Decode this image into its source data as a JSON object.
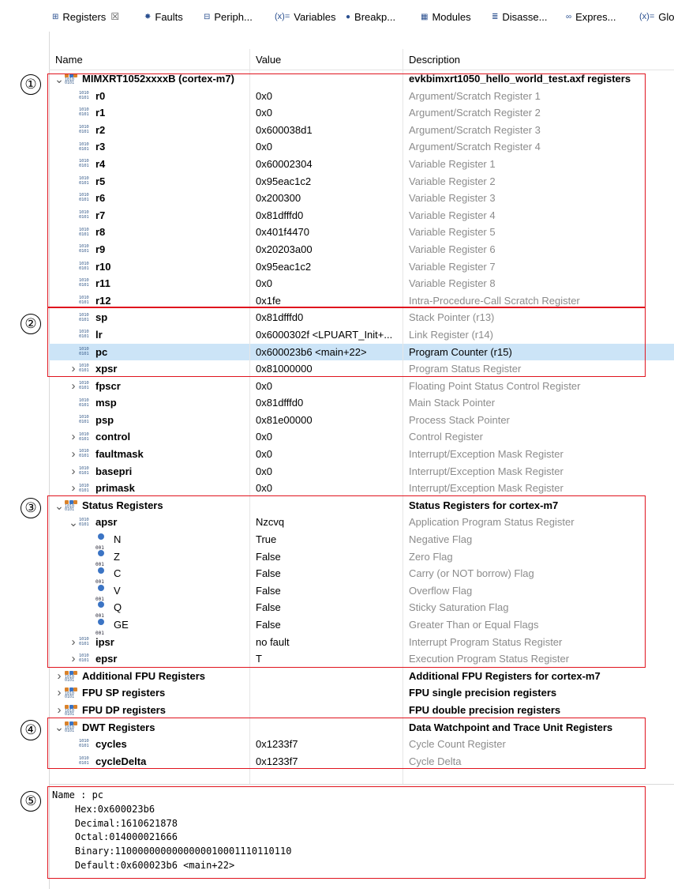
{
  "tabs": [
    {
      "label": "Registers",
      "icon": "registers-icon",
      "active": true
    },
    {
      "label": "Faults",
      "icon": "faults-icon"
    },
    {
      "label": "Periph...",
      "icon": "peripherals-icon"
    },
    {
      "label": "Variables",
      "icon_text": "(x)="
    },
    {
      "label": "Breakp...",
      "icon": "breakpoints-icon"
    },
    {
      "label": "Modules",
      "icon": "modules-icon"
    },
    {
      "label": "Disasse...",
      "icon": "disassembly-icon"
    },
    {
      "label": "Expres...",
      "icon": "expressions-icon"
    },
    {
      "label": "Glo",
      "icon_text": "(x)="
    }
  ],
  "columns": {
    "name": "Name",
    "value": "Value",
    "description": "Description"
  },
  "rows": [
    {
      "name": "MIMXRT1052xxxxB (cortex-m7)",
      "value": "",
      "desc": "evkbimxrt1050_hello_world_test.axf registers",
      "level": 0,
      "twist": "open",
      "icon": "group",
      "group": true
    },
    {
      "name": "r0",
      "value": "0x0",
      "desc": "Argument/Scratch Register 1",
      "level": 1,
      "icon": "bin"
    },
    {
      "name": "r1",
      "value": "0x0",
      "desc": "Argument/Scratch Register 2",
      "level": 1,
      "icon": "bin"
    },
    {
      "name": "r2",
      "value": "0x600038d1",
      "desc": "Argument/Scratch Register 3",
      "level": 1,
      "icon": "bin"
    },
    {
      "name": "r3",
      "value": "0x0",
      "desc": "Argument/Scratch Register 4",
      "level": 1,
      "icon": "bin"
    },
    {
      "name": "r4",
      "value": "0x60002304",
      "desc": "Variable Register 1",
      "level": 1,
      "icon": "bin"
    },
    {
      "name": "r5",
      "value": "0x95eac1c2",
      "desc": "Variable Register 2",
      "level": 1,
      "icon": "bin"
    },
    {
      "name": "r6",
      "value": "0x200300",
      "desc": "Variable Register 3",
      "level": 1,
      "icon": "bin"
    },
    {
      "name": "r7",
      "value": "0x81dfffd0",
      "desc": "Variable Register 4",
      "level": 1,
      "icon": "bin"
    },
    {
      "name": "r8",
      "value": "0x401f4470",
      "desc": "Variable Register 5",
      "level": 1,
      "icon": "bin"
    },
    {
      "name": "r9",
      "value": "0x20203a00",
      "desc": "Variable Register 6",
      "level": 1,
      "icon": "bin"
    },
    {
      "name": "r10",
      "value": "0x95eac1c2",
      "desc": "Variable Register 7",
      "level": 1,
      "icon": "bin"
    },
    {
      "name": "r11",
      "value": "0x0",
      "desc": "Variable Register 8",
      "level": 1,
      "icon": "bin"
    },
    {
      "name": "r12",
      "value": "0x1fe",
      "desc": "Intra-Procedure-Call Scratch Register",
      "level": 1,
      "icon": "bin"
    },
    {
      "name": "sp",
      "value": "0x81dfffd0",
      "desc": "Stack Pointer (r13)",
      "level": 1,
      "icon": "bin"
    },
    {
      "name": "lr",
      "value": "0x6000302f <LPUART_Init+...",
      "desc": "Link Register (r14)",
      "level": 1,
      "icon": "bin"
    },
    {
      "name": "pc",
      "value": "0x600023b6 <main+22>",
      "desc": "Program Counter (r15)",
      "level": 1,
      "icon": "bin",
      "selected": true
    },
    {
      "name": "xpsr",
      "value": "0x81000000",
      "desc": "Program Status Register",
      "level": 1,
      "twist": "closed",
      "icon": "bin"
    },
    {
      "name": "fpscr",
      "value": "0x0",
      "desc": "Floating Point Status Control Register",
      "level": 1,
      "twist": "closed",
      "icon": "bin"
    },
    {
      "name": "msp",
      "value": "0x81dfffd0",
      "desc": "Main Stack Pointer",
      "level": 1,
      "icon": "bin"
    },
    {
      "name": "psp",
      "value": "0x81e00000",
      "desc": "Process Stack Pointer",
      "level": 1,
      "icon": "bin"
    },
    {
      "name": "control",
      "value": "0x0",
      "desc": "Control Register",
      "level": 1,
      "twist": "closed",
      "icon": "bin"
    },
    {
      "name": "faultmask",
      "value": "0x0",
      "desc": "Interrupt/Exception Mask Register",
      "level": 1,
      "twist": "closed",
      "icon": "bin"
    },
    {
      "name": "basepri",
      "value": "0x0",
      "desc": "Interrupt/Exception Mask Register",
      "level": 1,
      "twist": "closed",
      "icon": "bin"
    },
    {
      "name": "primask",
      "value": "0x0",
      "desc": "Interrupt/Exception Mask Register",
      "level": 1,
      "twist": "closed",
      "icon": "bin"
    },
    {
      "name": "Status Registers",
      "value": "",
      "desc": "Status Registers for cortex-m7",
      "level": 0,
      "twist": "open",
      "icon": "group",
      "group": true
    },
    {
      "name": "apsr",
      "value": "Nzcvq",
      "desc": "Application Program Status Register",
      "level": 1,
      "twist": "open",
      "icon": "bin"
    },
    {
      "name": "N",
      "value": "True",
      "desc": "Negative Flag",
      "level": 2,
      "icon": "flag"
    },
    {
      "name": "Z",
      "value": "False",
      "desc": "Zero Flag",
      "level": 2,
      "icon": "flag"
    },
    {
      "name": "C",
      "value": "False",
      "desc": "Carry (or NOT borrow) Flag",
      "level": 2,
      "icon": "flag"
    },
    {
      "name": "V",
      "value": "False",
      "desc": "Overflow Flag",
      "level": 2,
      "icon": "flag"
    },
    {
      "name": "Q",
      "value": "False",
      "desc": "Sticky Saturation Flag",
      "level": 2,
      "icon": "flag"
    },
    {
      "name": "GE",
      "value": "False",
      "desc": "Greater Than or Equal Flags",
      "level": 2,
      "icon": "flag"
    },
    {
      "name": "ipsr",
      "value": "no fault",
      "desc": "Interrupt Program Status Register",
      "level": 1,
      "twist": "closed",
      "icon": "bin"
    },
    {
      "name": "epsr",
      "value": "T",
      "desc": "Execution Program Status Register",
      "level": 1,
      "twist": "closed",
      "icon": "bin"
    },
    {
      "name": "Additional FPU Registers",
      "value": "",
      "desc": "Additional FPU Registers for cortex-m7",
      "level": 0,
      "twist": "closed",
      "icon": "group",
      "group": true
    },
    {
      "name": "FPU SP registers",
      "value": "",
      "desc": "FPU single precision registers",
      "level": 0,
      "twist": "closed",
      "icon": "group",
      "group": true
    },
    {
      "name": "FPU DP registers",
      "value": "",
      "desc": "FPU double precision registers",
      "level": 0,
      "twist": "closed",
      "icon": "group",
      "group": true
    },
    {
      "name": "DWT Registers",
      "value": "",
      "desc": "Data Watchpoint and Trace Unit Registers",
      "level": 0,
      "twist": "open",
      "icon": "group",
      "group": true
    },
    {
      "name": "cycles",
      "value": "0x1233f7",
      "desc": "Cycle Count Register",
      "level": 1,
      "icon": "bin"
    },
    {
      "name": "cycleDelta",
      "value": "0x1233f7",
      "desc": "Cycle Delta",
      "level": 1,
      "icon": "bin"
    }
  ],
  "detail_lines": [
    "Name : pc",
    "    Hex:0x600023b6",
    "    Decimal:1610621878",
    "    Octal:014000021666",
    "    Binary:1100000000000000010001110110110",
    "    Default:0x600023b6 <main+22>"
  ],
  "callouts": [
    "①",
    "②",
    "③",
    "④",
    "⑤"
  ],
  "colors": {
    "selection": "#cce4f7",
    "callout_border": "#e0141e",
    "description_text": "#8c8c8c"
  }
}
